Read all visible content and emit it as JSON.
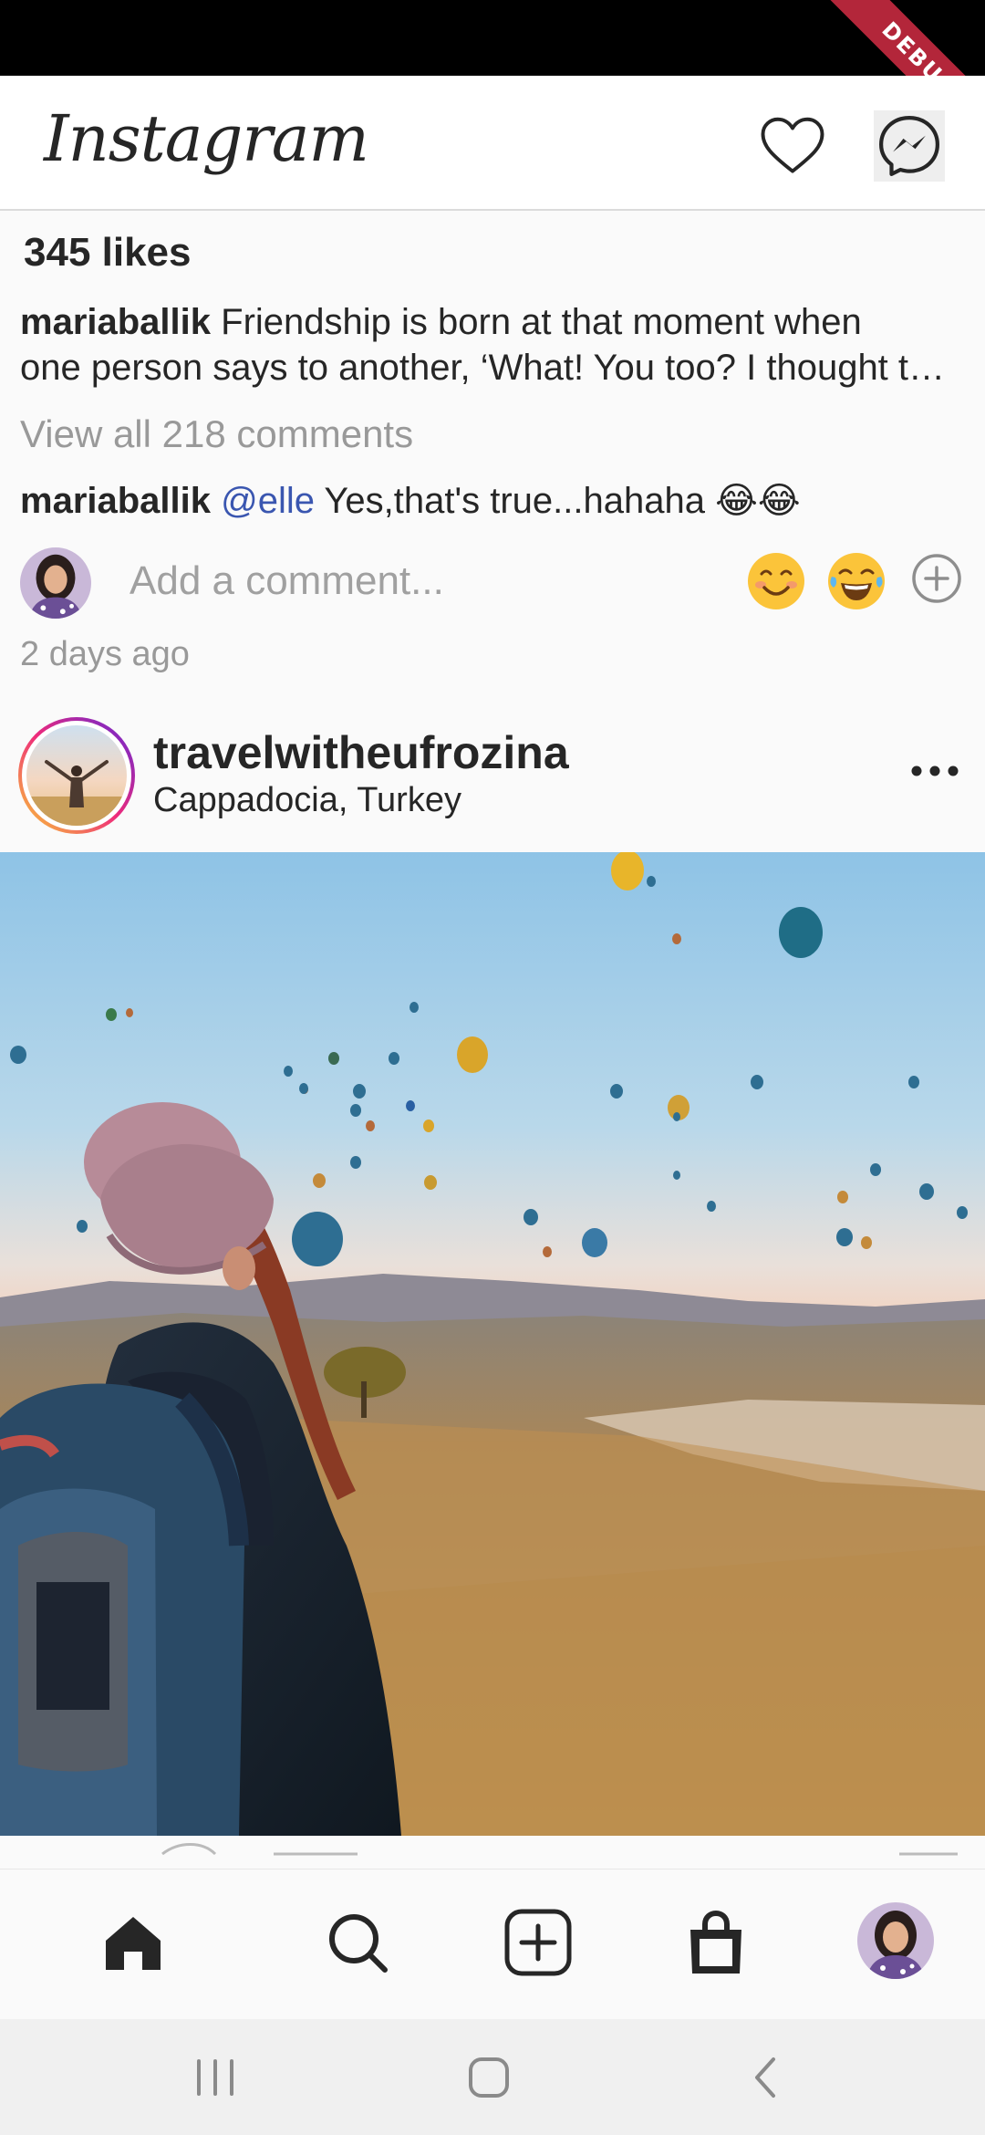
{
  "app": {
    "title": "Instagram",
    "debug_banner": "DEBUG"
  },
  "previous_post": {
    "likes": "345 likes",
    "caption": {
      "username": "mariaballik",
      "text_line1": "Friendship is born at that moment when",
      "text_line2": "one person says to another, ‘What! You too? I thought that no one but myself…’"
    },
    "view_comments": "View all 218 comments",
    "comment": {
      "username": "mariaballik",
      "mention": "@elle",
      "text": "Yes,that's true...hahaha 😂😂"
    },
    "add_comment_placeholder": "Add a comment...",
    "quick_emojis": [
      "😊",
      "😂"
    ],
    "timestamp": "2 days ago"
  },
  "post": {
    "username": "travelwitheufrozina",
    "location": "Cappadocia, Turkey"
  },
  "bottom_nav": {
    "items": [
      {
        "icon": "home-icon",
        "active": true
      },
      {
        "icon": "search-icon"
      },
      {
        "icon": "add-post-icon"
      },
      {
        "icon": "shop-bag-icon"
      },
      {
        "icon": "profile-avatar"
      }
    ]
  },
  "system_nav": [
    "recents-icon",
    "home-circle-icon",
    "back-icon"
  ],
  "colors": {
    "mention": "#3a56b0",
    "debug": "#b3263a",
    "story_ring": [
      "#f9ce34",
      "#ee2a7b",
      "#6228d7"
    ]
  }
}
